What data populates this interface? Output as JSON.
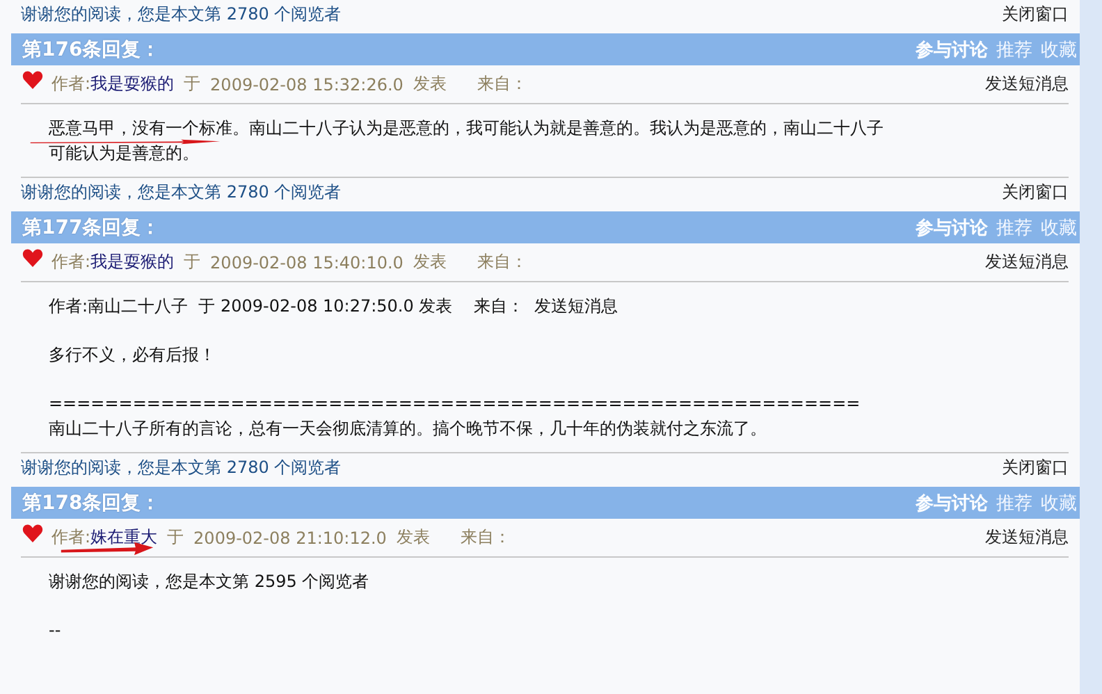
{
  "top_footer": {
    "thanks": "谢谢您的阅读，您是本文第 2780 个阅览者",
    "close": "关闭窗口"
  },
  "posts": [
    {
      "title": "第176条回复：",
      "actions": [
        "参与讨论",
        "推荐",
        "收藏"
      ],
      "author_label": "作者:",
      "author": "我是耍猴的",
      "at": "于",
      "time": "2009-02-08 15:32:26.0",
      "posted": "发表",
      "from": "来自：",
      "message_link": "发送短消息",
      "arrow_under_author": false,
      "arrow_under_text": true,
      "body": [
        {
          "text": "恶意马甲，没有一个标准。南山二十八子认为是恶意的，我可能认为就是善意的。我认为是恶意的，南山二十八子",
          "spaced": false
        },
        {
          "text": "可能认为是善意的。",
          "spaced": false
        }
      ],
      "footer": {
        "thanks": "谢谢您的阅读，您是本文第 2780 个阅览者",
        "close": "关闭窗口"
      }
    },
    {
      "title": "第177条回复：",
      "actions": [
        "参与讨论",
        "推荐",
        "收藏"
      ],
      "author_label": "作者:",
      "author": "我是耍猴的",
      "at": "于",
      "time": "2009-02-08 15:40:10.0",
      "posted": "发表",
      "from": "来自：",
      "message_link": "发送短消息",
      "arrow_under_author": false,
      "arrow_under_text": false,
      "body": [
        {
          "text": "作者:南山二十八子  于 2009-02-08 10:27:50.0 发表    来自：  发送短消息",
          "spaced": false
        },
        {
          "text": "多行不义，必有后报！",
          "spaced": true
        },
        {
          "text": "==========================================================",
          "spaced": true
        },
        {
          "text": "南山二十八子所有的言论，总有一天会彻底清算的。搞个晚节不保，几十年的伪装就付之东流了。",
          "spaced": false
        }
      ],
      "footer": {
        "thanks": "谢谢您的阅读，您是本文第 2780 个阅览者",
        "close": "关闭窗口"
      }
    },
    {
      "title": "第178条回复：",
      "actions": [
        "参与讨论",
        "推荐",
        "收藏"
      ],
      "author_label": "作者:",
      "author": "姝在重大",
      "at": "于",
      "time": "2009-02-08 21:10:12.0",
      "posted": "发表",
      "from": "来自：",
      "message_link": "发送短消息",
      "arrow_under_author": true,
      "arrow_under_text": false,
      "body": [
        {
          "text": "谢谢您的阅读，您是本文第 2595 个阅览者",
          "spaced": false
        },
        {
          "text": "--",
          "spaced": true
        }
      ]
    }
  ]
}
